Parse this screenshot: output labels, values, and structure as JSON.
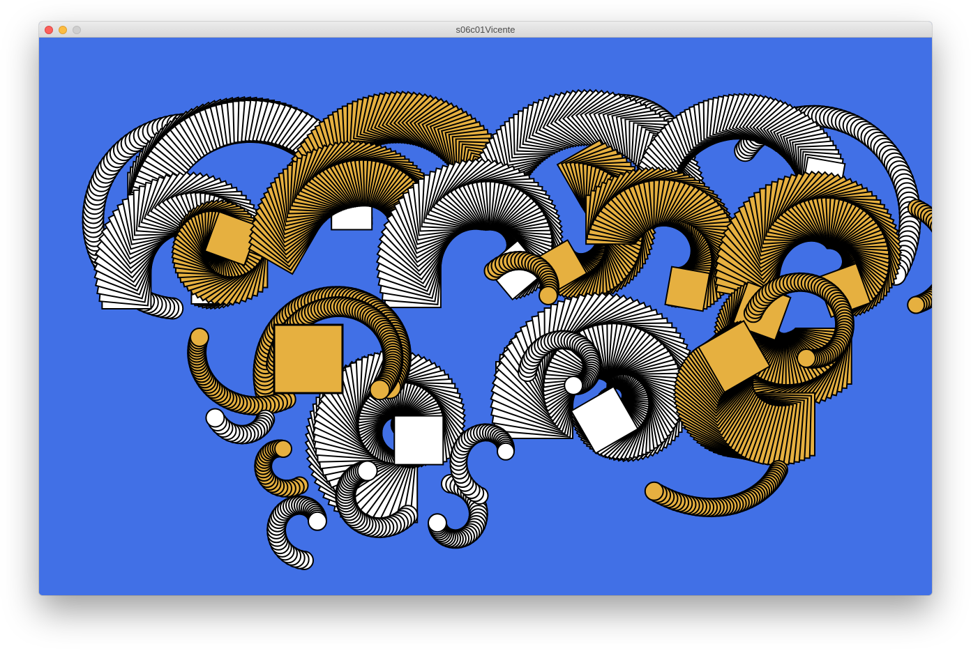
{
  "window": {
    "title": "s06c01Vicente",
    "controls": {
      "close": "close-icon",
      "minimize": "minimize-icon",
      "zoom": "zoom-icon"
    }
  },
  "canvas": {
    "background": "#4170e6",
    "colors": {
      "gold": "#e6b040",
      "white": "#ffffff",
      "stroke": "#000000"
    }
  }
}
